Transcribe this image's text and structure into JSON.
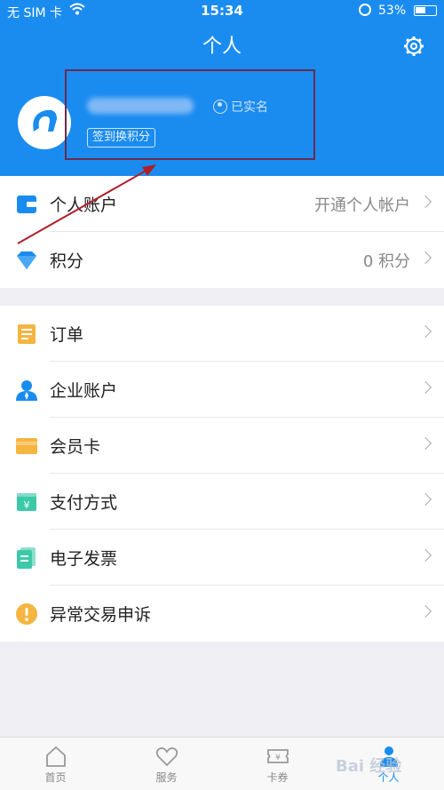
{
  "status_bar": {
    "carrier": "无 SIM 卡",
    "time": "15:34",
    "battery": "53%",
    "battery_level": 0.53
  },
  "nav": {
    "title": "个人"
  },
  "profile": {
    "verified_label": "已实名",
    "signin_label": "签到换积分"
  },
  "account_section": [
    {
      "label": "个人账户",
      "value": "开通个人帐户",
      "icon": "wallet-icon"
    },
    {
      "label": "积分",
      "value": "0 积分",
      "icon": "diamond-icon"
    }
  ],
  "menu_section": [
    {
      "label": "订单",
      "icon": "order-icon"
    },
    {
      "label": "企业账户",
      "icon": "enterprise-user-icon"
    },
    {
      "label": "会员卡",
      "icon": "card-icon"
    },
    {
      "label": "支付方式",
      "icon": "payment-icon"
    },
    {
      "label": "电子发票",
      "icon": "invoice-icon"
    },
    {
      "label": "异常交易申诉",
      "icon": "warning-icon"
    }
  ],
  "tabbar": [
    {
      "label": "首页",
      "icon": "home-icon"
    },
    {
      "label": "服务",
      "icon": "heart-icon"
    },
    {
      "label": "卡券",
      "icon": "ticket-icon"
    },
    {
      "label": "个人",
      "icon": "person-icon"
    }
  ],
  "colors": {
    "primary": "#1a8cf0",
    "annotation": "#b01e2a"
  },
  "watermark": "Bai 经验"
}
